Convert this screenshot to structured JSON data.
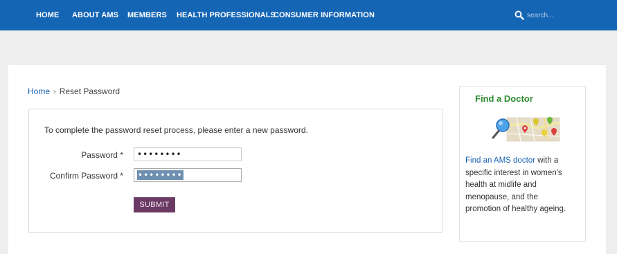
{
  "nav": {
    "items": [
      "HOME",
      "ABOUT AMS",
      "MEMBERS",
      "HEALTH PROFESSIONALS",
      "CONSUMER INFORMATION"
    ],
    "search_placeholder": "search...",
    "bar_color": "#1565b5"
  },
  "breadcrumb": {
    "home": "Home",
    "separator": "›",
    "current": "Reset Password"
  },
  "form": {
    "intro": "To complete the password reset process, please enter a new password.",
    "password_label": "Password *",
    "password_value": "••••••••",
    "confirm_label": "Confirm Password *",
    "confirm_value": "••••••••",
    "submit_label": "SUBMIT",
    "submit_color": "#6b3a64"
  },
  "sidebar": {
    "title": "Find a Doctor",
    "map_icon": "map-magnifier-icon",
    "link_text": "Find an AMS doctor",
    "body_text": " with a specific interest in women's health at midlife and menopause, and the promotion of healthy ageing."
  }
}
